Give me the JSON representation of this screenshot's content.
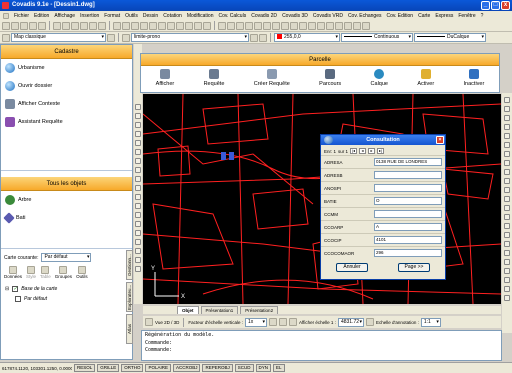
{
  "window": {
    "title": "Covadis 9.1e - [Dessin1.dwg]",
    "buttons": [
      "_",
      "□",
      "x"
    ]
  },
  "menu": [
    "Fichier",
    "Edition",
    "Affichage",
    "Insertion",
    "Format",
    "Outils",
    "Dessin",
    "Cotation",
    "Modification",
    "Cov. Calculs",
    "Covadis 2D",
    "Covadis 3D",
    "Covadis VRD",
    "Cov. Echanges",
    "Cov. Edition",
    "Carte",
    "Express",
    "Fenêtre",
    "?"
  ],
  "toolbar2": {
    "workspace": "Map classique",
    "layer": "limite-prono",
    "color": "255,0,0",
    "linetype": "Continuous",
    "lineweight": "DuCalque"
  },
  "cadastre": {
    "title": "Cadastre",
    "items": [
      {
        "label": "Urbanisme",
        "icon": "globe-icon"
      },
      {
        "label": "Ouvrir dossier",
        "icon": "globe-icon"
      },
      {
        "label": "Afficher Contexte",
        "icon": "gear-icon"
      },
      {
        "label": "Assistant Requête",
        "icon": "wizard-icon"
      }
    ]
  },
  "tous_objets": {
    "title": "Tous les objets",
    "items": [
      {
        "label": "Arbre",
        "icon": "tree-icon"
      },
      {
        "label": "Bati",
        "icon": "building-icon"
      }
    ]
  },
  "map_panel": {
    "carte_label": "Carte courante:",
    "carte_value": "Par défaut",
    "tools": [
      "Données",
      "Style",
      "Table",
      "Groupes",
      "Outils"
    ],
    "tree_root": "Base de la carte",
    "tree_child": "Par défaut",
    "side_tabs": [
      "Gestionn...",
      "Explorateu...",
      "Atlas"
    ]
  },
  "parcelle": {
    "title": "Parcelle",
    "buttons": [
      "Afficher",
      "Requête",
      "Créer Requête",
      "Parcours",
      "Calque",
      "Activer",
      "Inactiver"
    ]
  },
  "consultation": {
    "title": "Consultation",
    "nav_label": "Enr: 1",
    "nav_of": "sur 1",
    "fields": [
      {
        "label": "ADRESA",
        "value": "0138 RUE DE LONDRES"
      },
      {
        "label": "ADRESB",
        "value": ""
      },
      {
        "label": "ANOSPI",
        "value": ""
      },
      {
        "label": "BATIE",
        "value": "O"
      },
      {
        "label": "CCMM",
        "value": ""
      },
      {
        "label": "CCOARP",
        "value": "A"
      },
      {
        "label": "CCOCIP",
        "value": "4101"
      },
      {
        "label": "CCOCOMAOR",
        "value": "296"
      }
    ],
    "cancel_label": "Annuler",
    "next_label": "Page >>"
  },
  "layout_tabs": [
    "Objet",
    "Présentation1",
    "Présentation2"
  ],
  "viewbar": {
    "view": "Vue 2D / 3D",
    "factor_label": "Facteur d'échelle verticale :",
    "factor_value": "1x",
    "scale_label": "Afficher échelle 1 :",
    "scale_value": "4831.72",
    "annot_label": "Echelle d'annotation :",
    "annot_value": "1:1"
  },
  "command": {
    "lines": [
      "Régénération du modèle.",
      "Commande:",
      "Commande:"
    ]
  },
  "status": {
    "coords": "617874.1120, 103301.1250, 0.0000",
    "modes": [
      "RESOL",
      "GRILLE",
      "ORTHO",
      "POLAIRE",
      "ACCROBJ",
      "REPEROBJ",
      "SCUD",
      "DYN",
      "EL"
    ]
  },
  "colors": {
    "drawing_bg": "#000000",
    "lines": "#ff2020",
    "panel_orange": "#f7a92a",
    "titlebar": "#0a58d8"
  }
}
